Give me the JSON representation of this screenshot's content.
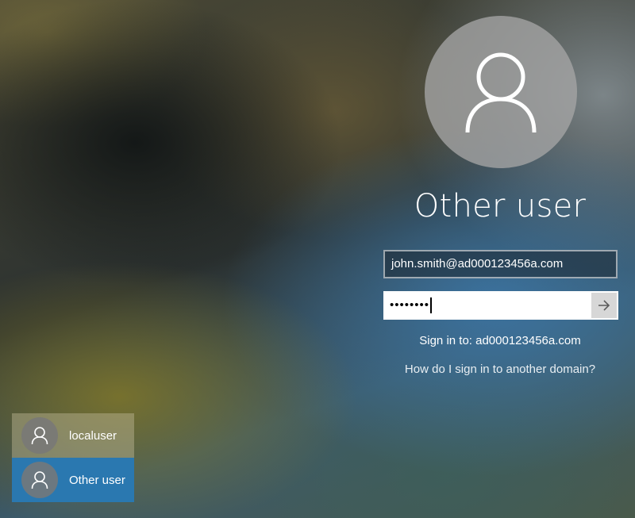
{
  "current_user": {
    "name": "Other user",
    "avatar_icon": "user-icon"
  },
  "form": {
    "username_value": "john.smith@ad000123456a.com",
    "password_value": "••••••••",
    "submit_icon": "arrow-right-icon"
  },
  "signin_info": "Sign in to: ad000123456a.com",
  "other_domain_link": "How do I sign in to another domain?",
  "user_list": {
    "items": [
      {
        "label": "localuser",
        "icon": "user-icon",
        "selected": false
      },
      {
        "label": "Other user",
        "icon": "user-icon",
        "selected": true
      }
    ]
  },
  "colors": {
    "selected_tile": "#2a78b0",
    "avatar_circle": "#a5a5a5"
  }
}
